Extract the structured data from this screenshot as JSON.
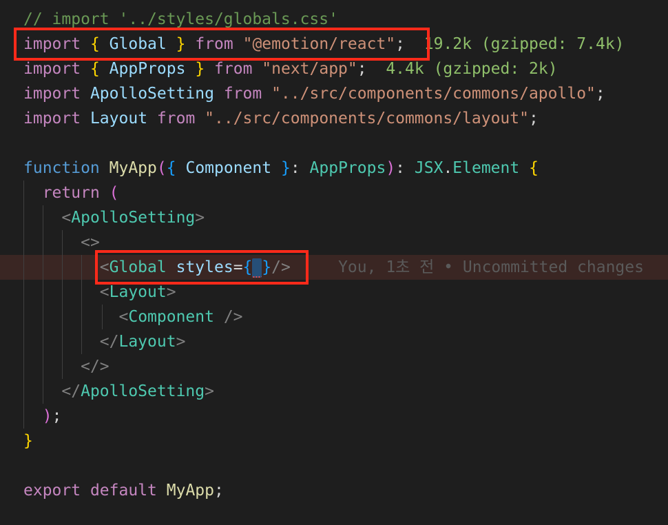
{
  "editor": {
    "lines": {
      "l1": {
        "kw1": "// import '../styles/globals.css'"
      },
      "l2": {
        "kw": "import",
        "b1": "{",
        "name": "Global",
        "b2": "}",
        "from": "from",
        "str": "\"@emotion/react\"",
        "semi": ";",
        "hint": "19.2k (gzipped: 7.4k)"
      },
      "l3": {
        "kw": "import",
        "b1": "{",
        "name": "AppProps",
        "b2": "}",
        "from": "from",
        "str": "\"next/app\"",
        "semi": ";",
        "hint": "4.4k (gzipped: 2k)"
      },
      "l4": {
        "kw": "import",
        "name": "ApolloSetting",
        "from": "from",
        "str": "\"../src/components/commons/apollo\"",
        "semi": ";"
      },
      "l5": {
        "kw": "import",
        "name": "Layout",
        "from": "from",
        "str": "\"../src/components/commons/layout\"",
        "semi": ";"
      },
      "l7": {
        "kw": "function",
        "name": "MyApp",
        "p1": "(",
        "b1": "{",
        "param": "Component",
        "b2": "}",
        "colon": ":",
        "type": "AppProps",
        "p2": ")",
        "colon2": ":",
        "ret1": "JSX",
        "dot": ".",
        "ret2": "Element",
        "b3": "{"
      },
      "l8": {
        "kw": "return",
        "p1": "("
      },
      "l9": {
        "open": "<",
        "tag": "ApolloSetting",
        "close": ">"
      },
      "l10": {
        "frag": "<>"
      },
      "l11": {
        "open": "<",
        "tag": "Global",
        "attr": "styles",
        "eq": "=",
        "b1": "{",
        "space": " ",
        "b2": "}",
        "close": "/>",
        "blame": "You, 1초 전 • Uncommitted changes"
      },
      "l12": {
        "open": "<",
        "tag": "Layout",
        "close": ">"
      },
      "l13": {
        "open": "<",
        "tag": "Component",
        "close": " />"
      },
      "l14": {
        "open": "</",
        "tag": "Layout",
        "close": ">"
      },
      "l15": {
        "frag": "</>"
      },
      "l16": {
        "open": "</",
        "tag": "ApolloSetting",
        "close": ">"
      },
      "l17": {
        "p": ")",
        "semi": ";"
      },
      "l18": {
        "b": "}"
      },
      "l20": {
        "kw1": "export",
        "kw2": "default",
        "name": "MyApp",
        "semi": ";"
      }
    }
  },
  "colors": {
    "background": "#1e1e1e",
    "highlight_box": "#ff2a1a",
    "current_line": "#3a2623"
  }
}
